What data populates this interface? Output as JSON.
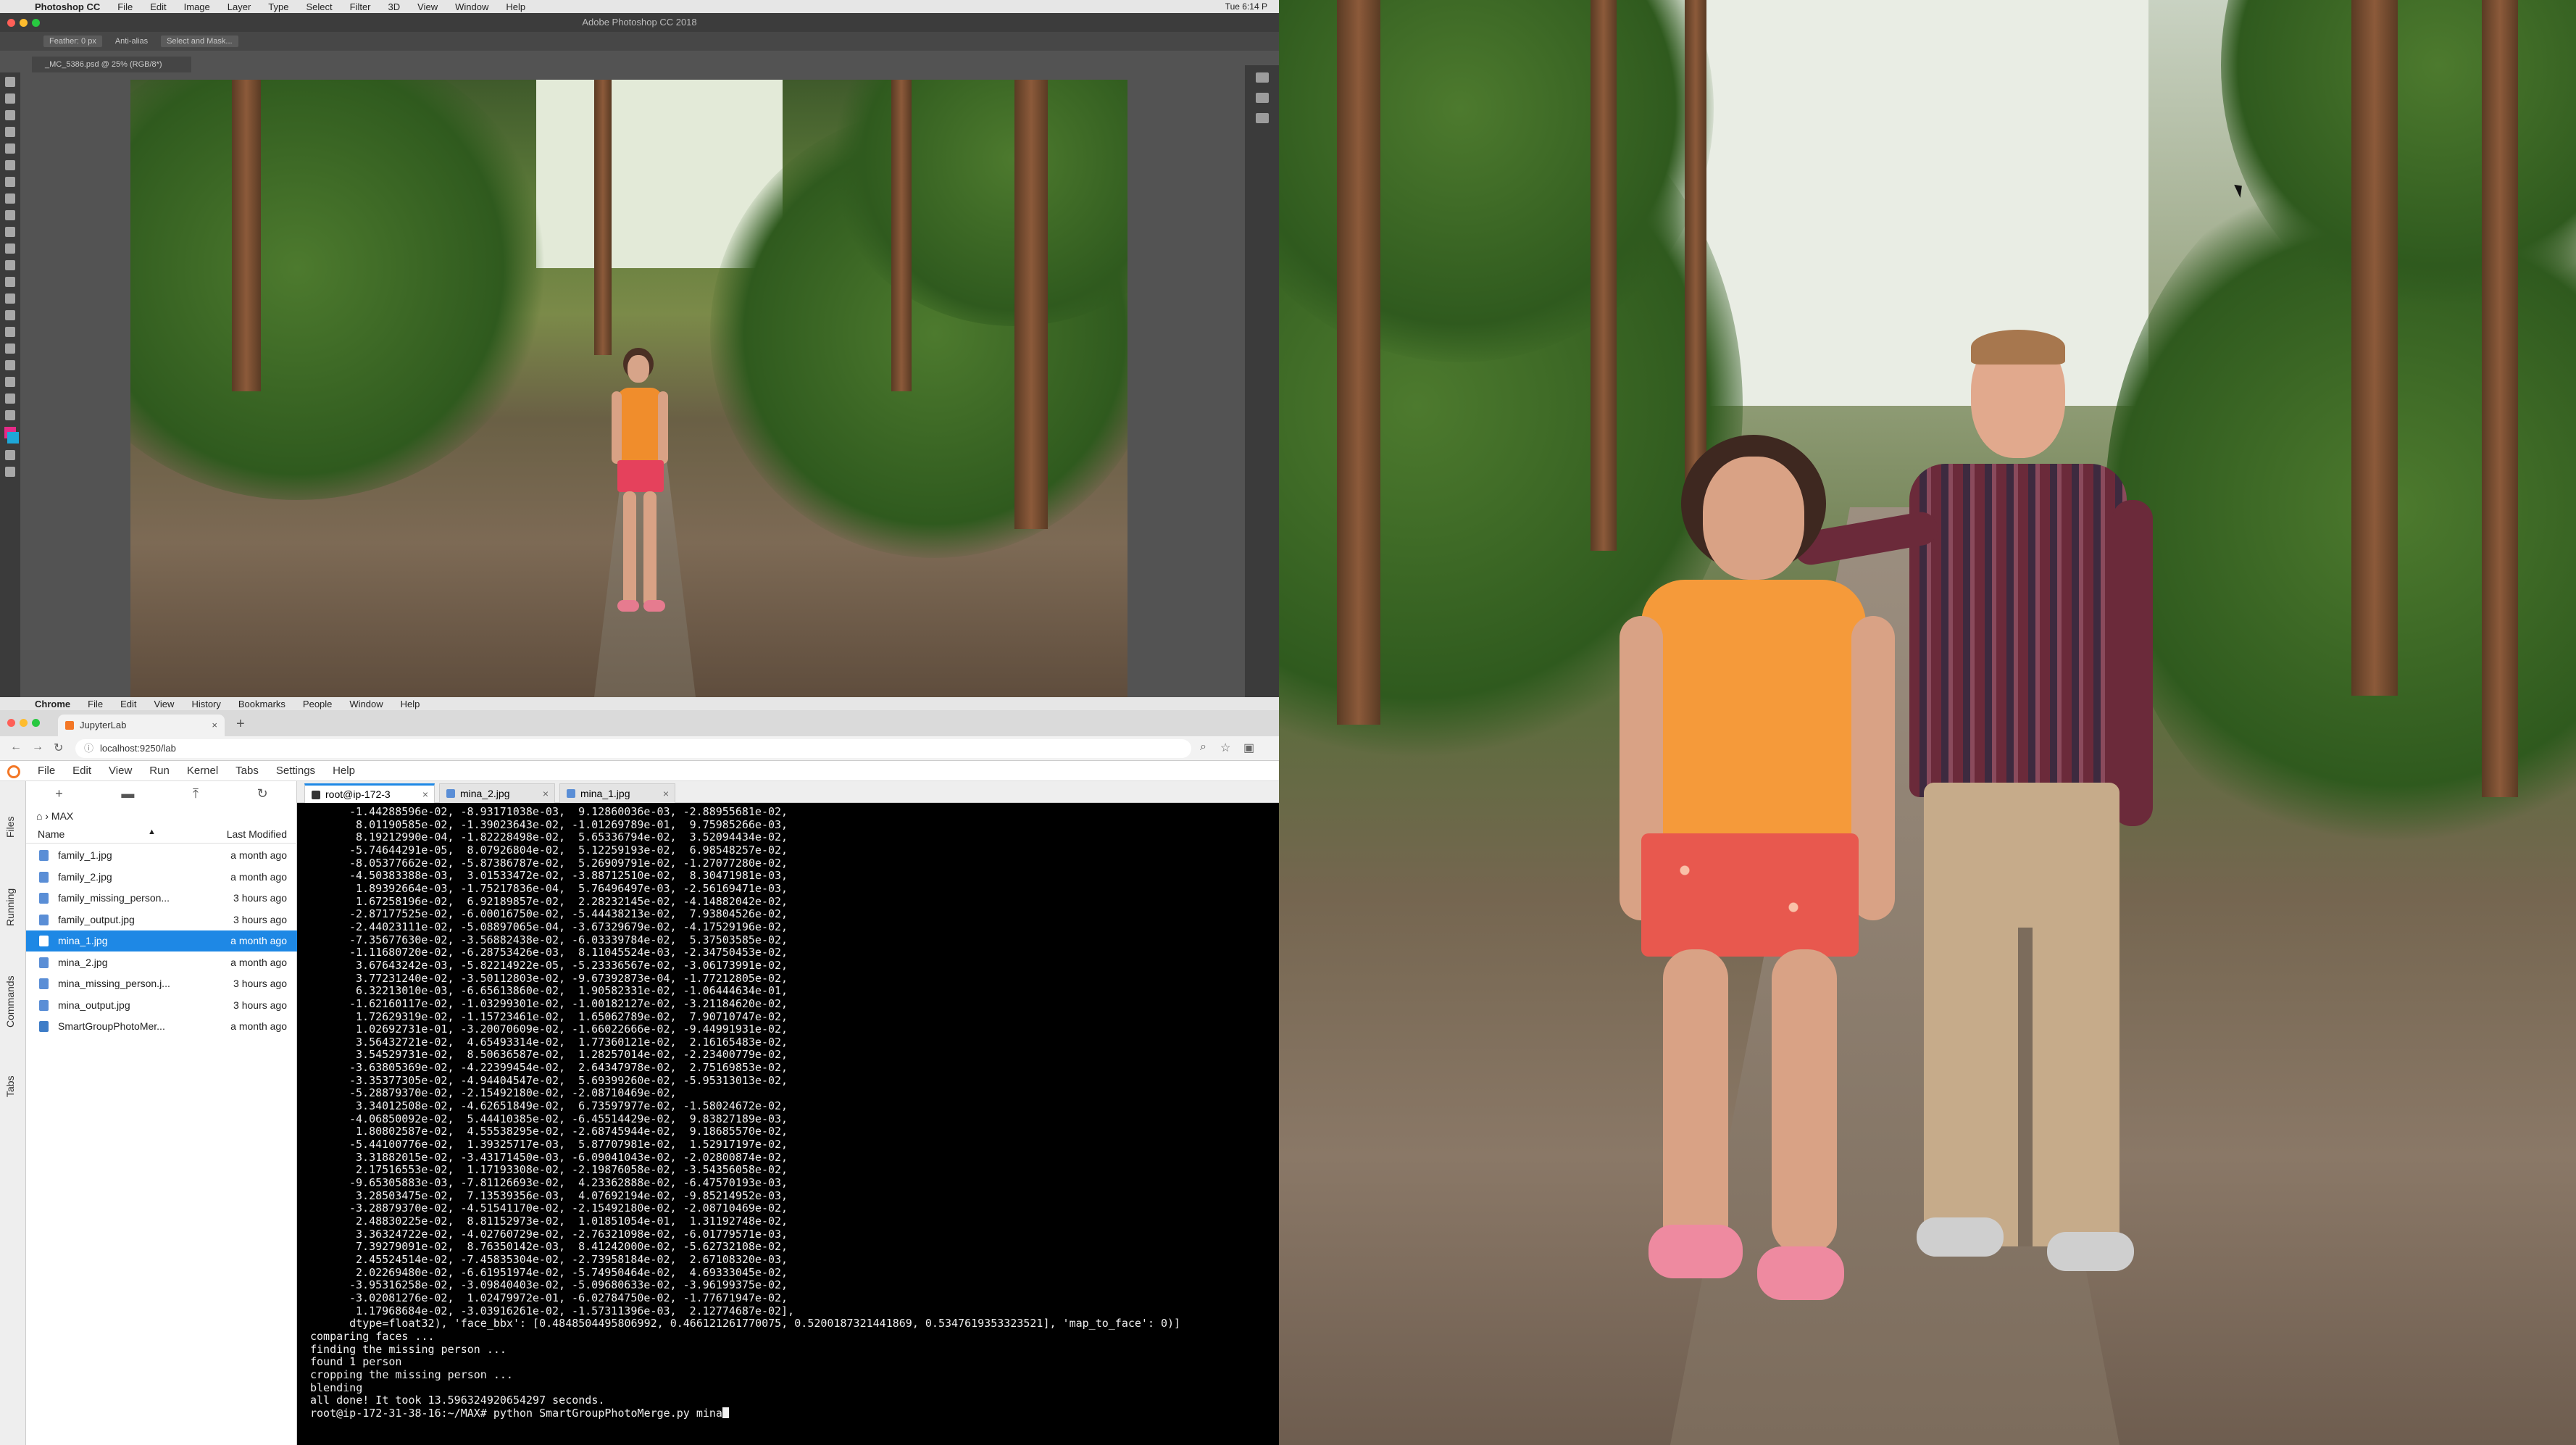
{
  "photoshop": {
    "menubar": [
      "Photoshop CC",
      "File",
      "Edit",
      "Image",
      "Layer",
      "Type",
      "Select",
      "Filter",
      "3D",
      "View",
      "Window",
      "Help"
    ],
    "clock": "Tue 6:14 P",
    "window_title": "Adobe Photoshop CC 2018",
    "options": {
      "feather": "Feather: 0 px",
      "antialias": "Anti-alias",
      "select_mask": "Select and Mask..."
    },
    "doc_tab": "_MC_5386.psd @ 25% (RGB/8*)",
    "colors": {
      "foreground": "#e52a87",
      "background": "#1ea7d8"
    }
  },
  "chrome": {
    "menubar": [
      "Chrome",
      "File",
      "Edit",
      "View",
      "History",
      "Bookmarks",
      "People",
      "Window",
      "Help"
    ],
    "tab_title": "JupyterLab",
    "url": "localhost:9250/lab"
  },
  "jupyter": {
    "menu": [
      "File",
      "Edit",
      "View",
      "Run",
      "Kernel",
      "Tabs",
      "Settings",
      "Help"
    ],
    "sidebar_tabs": [
      "Files",
      "Running",
      "Commands",
      "Tabs"
    ],
    "breadcrumb": "MAX",
    "file_columns": {
      "name": "Name",
      "modified": "Last Modified"
    },
    "files": [
      {
        "name": "family_1.jpg",
        "modified": "a month ago",
        "type": "image",
        "selected": false
      },
      {
        "name": "family_2.jpg",
        "modified": "a month ago",
        "type": "image",
        "selected": false
      },
      {
        "name": "family_missing_person...",
        "modified": "3 hours ago",
        "type": "image",
        "selected": false
      },
      {
        "name": "family_output.jpg",
        "modified": "3 hours ago",
        "type": "image",
        "selected": false
      },
      {
        "name": "mina_1.jpg",
        "modified": "a month ago",
        "type": "image",
        "selected": true
      },
      {
        "name": "mina_2.jpg",
        "modified": "a month ago",
        "type": "image",
        "selected": false
      },
      {
        "name": "mina_missing_person.j...",
        "modified": "3 hours ago",
        "type": "image",
        "selected": false
      },
      {
        "name": "mina_output.jpg",
        "modified": "3 hours ago",
        "type": "image",
        "selected": false
      },
      {
        "name": "SmartGroupPhotoMer...",
        "modified": "a month ago",
        "type": "python",
        "selected": false
      }
    ],
    "tabs": [
      {
        "label": "root@ip-172-3",
        "active": true
      },
      {
        "label": "mina_2.jpg",
        "active": false
      },
      {
        "label": "mina_1.jpg",
        "active": false
      }
    ]
  },
  "terminal": {
    "array_rows": [
      "-1.44288596e-02, -8.93171038e-03,  9.12860036e-03, -2.88955681e-02,",
      " 8.01190585e-02, -1.39023643e-02, -1.01269789e-01,  9.75985266e-03,",
      " 8.19212990e-04, -1.82228498e-02,  5.65336794e-02,  3.52094434e-02,",
      "-5.74644291e-05,  8.07926804e-02,  5.12259193e-02,  6.98548257e-02,",
      "-8.05377662e-02, -5.87386787e-02,  5.26909791e-02, -1.27077280e-02,",
      "-4.50383388e-03,  3.01533472e-02, -3.88712510e-02,  8.30471981e-03,",
      " 1.89392664e-03, -1.75217836e-04,  5.76496497e-03, -2.56169471e-03,",
      " 1.67258196e-02,  6.92189857e-02,  2.28232145e-02, -4.14882042e-02,",
      "-2.87177525e-02, -6.00016750e-02, -5.44438213e-02,  7.93804526e-02,",
      "-2.44023111e-02, -5.08897065e-04, -3.67329679e-02, -4.17529196e-02,",
      "-7.35677630e-02, -3.56882438e-02, -6.03339784e-02,  5.37503585e-02,",
      "-1.11680720e-02, -6.28753426e-03,  8.11045524e-03, -2.34750453e-02,",
      " 3.67643242e-03, -5.82214922e-05, -5.23336567e-02, -3.06173991e-02,",
      " 3.77231240e-02, -3.50112803e-02, -9.67392873e-04, -1.77212805e-02,",
      " 6.32213010e-03, -6.65613860e-02,  1.90582331e-02, -1.06444634e-01,",
      "-1.62160117e-02, -1.03299301e-02, -1.00182127e-02, -3.21184620e-02,",
      " 1.72629319e-02, -1.15723461e-02,  1.65062789e-02,  7.90710747e-02,",
      " 1.02692731e-01, -3.20070609e-02, -1.66022666e-02, -9.44991931e-02,",
      " 3.56432721e-02,  4.65493314e-02,  1.77360121e-02,  2.16165483e-02,",
      " 3.54529731e-02,  8.50636587e-02,  1.28257014e-02, -2.23400779e-02,",
      "-3.63805369e-02, -4.22399454e-02,  2.64347978e-02,  2.75169853e-02,",
      "-3.35377305e-02, -4.94404547e-02,  5.69399260e-02, -5.95313013e-02,",
      "-5.28879370e-02, -2.15492180e-02, -2.08710469e-02,",
      " 3.34012508e-02, -4.62651849e-02,  6.73597977e-02, -1.58024672e-02,",
      "-4.06850092e-02,  5.44410385e-02, -6.45514429e-02,  9.83827189e-03,",
      " 1.80802587e-02,  4.55538295e-02, -2.68745944e-02,  9.18685570e-02,",
      "-5.44100776e-02,  1.39325717e-03,  5.87707981e-02,  1.52917197e-02,",
      " 3.31882015e-02, -3.43171450e-03, -6.09041043e-02, -2.02800874e-02,",
      " 2.17516553e-02,  1.17193308e-02, -2.19876058e-02, -3.54356058e-02,",
      "-9.65305883e-03, -7.81126693e-02,  4.23362888e-02, -6.47570193e-03,",
      " 3.28503475e-02,  7.13539356e-03,  4.07692194e-02, -9.85214952e-03,",
      "-3.28879370e-02, -4.51541170e-02, -2.15492180e-02, -2.08710469e-02,",
      " 2.48830225e-02,  8.81152973e-02,  1.01851054e-01,  1.31192748e-02,",
      " 3.36324722e-02, -4.02760729e-02, -2.76321098e-02, -6.01779571e-03,",
      " 7.39279091e-02,  8.76350142e-03,  8.41242000e-02, -5.62732108e-02,",
      " 2.45524514e-02, -7.45835304e-02, -2.73958184e-02,  2.67108320e-03,",
      " 2.02269480e-02, -6.61951974e-02, -5.74950464e-02,  4.69333045e-02,",
      "-3.95316258e-02, -3.09840403e-02, -5.09680633e-02, -3.96199375e-02,",
      "-3.02081276e-02,  1.02479972e-01, -6.02784750e-02, -1.77671947e-02,",
      " 1.17968684e-02, -3.03916261e-02, -1.57311396e-03,  2.12774687e-02],"
    ],
    "dtype_line": "      dtype=float32), 'face_bbx': [0.4848504495806992, 0.466121261770075, 0.5200187321441869, 0.5347619353323521], 'map_to_face': 0)]",
    "output_lines": [
      "comparing faces ...",
      "finding the missing person ...",
      "found 1 person",
      "cropping the missing person ...",
      "blending",
      "all done! It took 13.596324920654297 seconds."
    ],
    "prompt": "root@ip-172-31-38-16:~/MAX# python SmartGroupPhotoMerge.py mina"
  }
}
